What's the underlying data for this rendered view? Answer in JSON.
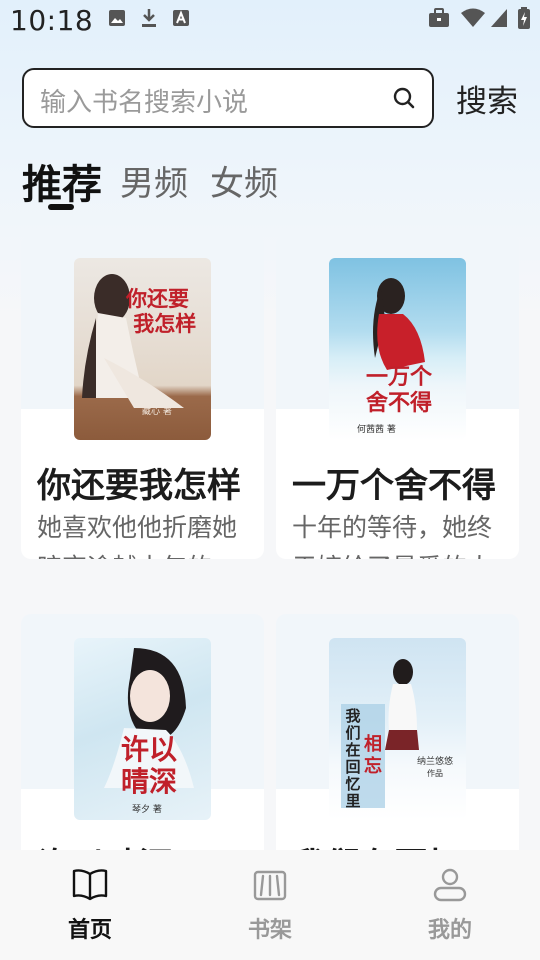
{
  "status_bar": {
    "time": "10:18",
    "left_icons": [
      "image-icon",
      "download-icon",
      "font-a-icon"
    ],
    "right_icons": [
      "briefcase-icon",
      "wifi-icon",
      "signal-icon",
      "battery-icon"
    ]
  },
  "search": {
    "placeholder": "输入书名搜索小说",
    "button_label": "搜索"
  },
  "tabs": [
    {
      "label": "推荐",
      "active": true
    },
    {
      "label": "男频",
      "active": false
    },
    {
      "label": "女频",
      "active": false
    }
  ],
  "books": [
    {
      "title": "你还要我怎样",
      "description": "她喜欢他他折磨她暗恋逾越十年的时光",
      "cover_title": "你还要我怎样",
      "cover_author": "藏心 著"
    },
    {
      "title": "一万个舍不得",
      "description": "十年的等待，她终于嫁给了最爱的人",
      "cover_title": "一万个舍不得",
      "cover_author": "何茜茜 著"
    },
    {
      "title": "许以晴深",
      "description": "",
      "cover_title": "许以晴深",
      "cover_author": "琴夕 著"
    },
    {
      "title": "我们在回忆里相忘",
      "description": "",
      "cover_title_vertical": "我们在回忆里",
      "cover_title_accent": "相忘",
      "cover_author": "纳兰悠悠",
      "cover_author_note": "作品"
    }
  ],
  "bottom_nav": [
    {
      "label": "首页",
      "icon": "open-book-icon",
      "active": true
    },
    {
      "label": "书架",
      "icon": "bookshelf-icon",
      "active": false
    },
    {
      "label": "我的",
      "icon": "user-icon",
      "active": false
    }
  ],
  "colors": {
    "accent_dark": "#111111",
    "inactive": "#999999",
    "cover_red": "#c0202a"
  }
}
